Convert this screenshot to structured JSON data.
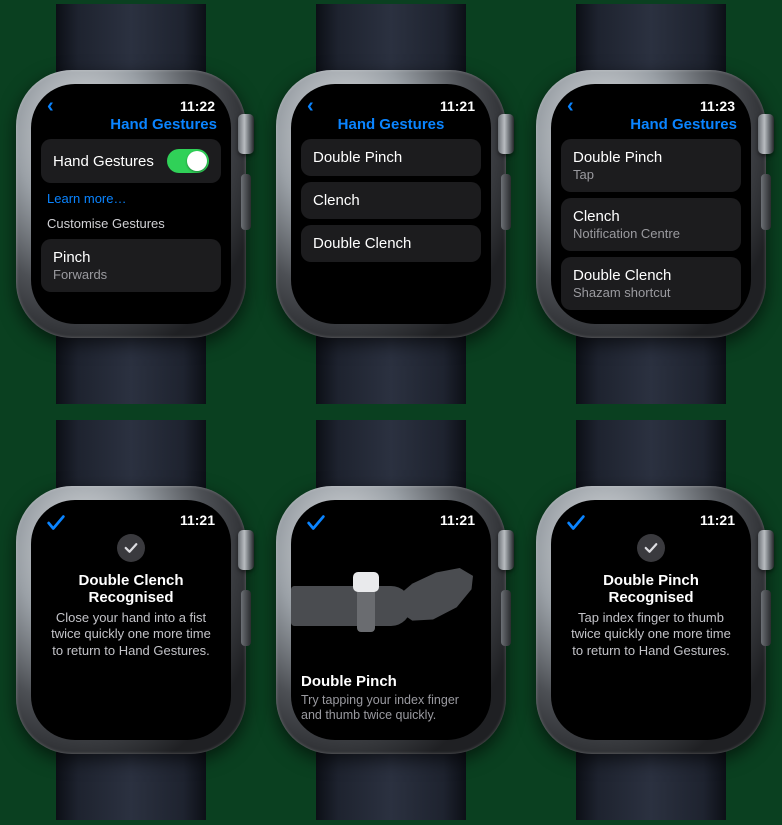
{
  "screens": {
    "s1": {
      "time": "11:22",
      "title": "Hand Gestures",
      "toggle_label": "Hand Gestures",
      "learn_more": "Learn more…",
      "section_label": "Customise Gestures",
      "pinch_label": "Pinch",
      "pinch_value": "Forwards"
    },
    "s2": {
      "time": "11:21",
      "title": "Hand Gestures",
      "items": [
        "Double Pinch",
        "Clench",
        "Double Clench"
      ]
    },
    "s3": {
      "time": "11:23",
      "title": "Hand Gestures",
      "rows": [
        {
          "label": "Double Pinch",
          "value": "Tap"
        },
        {
          "label": "Clench",
          "value": "Notification Centre"
        },
        {
          "label": "Double Clench",
          "value": "Shazam shortcut"
        }
      ]
    },
    "s4": {
      "time": "11:21",
      "heading": "Double Clench Recognised",
      "body": "Close your hand into a fist twice quickly one more time to return to Hand Gestures."
    },
    "s5": {
      "time": "11:21",
      "heading": "Double Pinch",
      "body": "Try tapping your index finger and thumb twice quickly."
    },
    "s6": {
      "time": "11:21",
      "heading": "Double Pinch Recognised",
      "body": "Tap index finger to thumb twice quickly one more time to return to Hand Gestures."
    }
  },
  "colors": {
    "accent": "#0a84ff",
    "toggle_on": "#30d158"
  }
}
